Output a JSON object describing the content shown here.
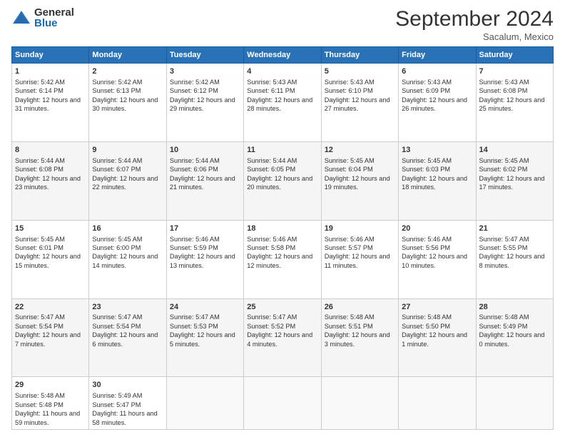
{
  "logo": {
    "general": "General",
    "blue": "Blue"
  },
  "title": "September 2024",
  "location": "Sacalum, Mexico",
  "days_header": [
    "Sunday",
    "Monday",
    "Tuesday",
    "Wednesday",
    "Thursday",
    "Friday",
    "Saturday"
  ],
  "weeks": [
    [
      {
        "day": "1",
        "info": "Sunrise: 5:42 AM\nSunset: 6:14 PM\nDaylight: 12 hours and 31 minutes."
      },
      {
        "day": "2",
        "info": "Sunrise: 5:42 AM\nSunset: 6:13 PM\nDaylight: 12 hours and 30 minutes."
      },
      {
        "day": "3",
        "info": "Sunrise: 5:42 AM\nSunset: 6:12 PM\nDaylight: 12 hours and 29 minutes."
      },
      {
        "day": "4",
        "info": "Sunrise: 5:43 AM\nSunset: 6:11 PM\nDaylight: 12 hours and 28 minutes."
      },
      {
        "day": "5",
        "info": "Sunrise: 5:43 AM\nSunset: 6:10 PM\nDaylight: 12 hours and 27 minutes."
      },
      {
        "day": "6",
        "info": "Sunrise: 5:43 AM\nSunset: 6:09 PM\nDaylight: 12 hours and 26 minutes."
      },
      {
        "day": "7",
        "info": "Sunrise: 5:43 AM\nSunset: 6:08 PM\nDaylight: 12 hours and 25 minutes."
      }
    ],
    [
      {
        "day": "8",
        "info": "Sunrise: 5:44 AM\nSunset: 6:08 PM\nDaylight: 12 hours and 23 minutes."
      },
      {
        "day": "9",
        "info": "Sunrise: 5:44 AM\nSunset: 6:07 PM\nDaylight: 12 hours and 22 minutes."
      },
      {
        "day": "10",
        "info": "Sunrise: 5:44 AM\nSunset: 6:06 PM\nDaylight: 12 hours and 21 minutes."
      },
      {
        "day": "11",
        "info": "Sunrise: 5:44 AM\nSunset: 6:05 PM\nDaylight: 12 hours and 20 minutes."
      },
      {
        "day": "12",
        "info": "Sunrise: 5:45 AM\nSunset: 6:04 PM\nDaylight: 12 hours and 19 minutes."
      },
      {
        "day": "13",
        "info": "Sunrise: 5:45 AM\nSunset: 6:03 PM\nDaylight: 12 hours and 18 minutes."
      },
      {
        "day": "14",
        "info": "Sunrise: 5:45 AM\nSunset: 6:02 PM\nDaylight: 12 hours and 17 minutes."
      }
    ],
    [
      {
        "day": "15",
        "info": "Sunrise: 5:45 AM\nSunset: 6:01 PM\nDaylight: 12 hours and 15 minutes."
      },
      {
        "day": "16",
        "info": "Sunrise: 5:45 AM\nSunset: 6:00 PM\nDaylight: 12 hours and 14 minutes."
      },
      {
        "day": "17",
        "info": "Sunrise: 5:46 AM\nSunset: 5:59 PM\nDaylight: 12 hours and 13 minutes."
      },
      {
        "day": "18",
        "info": "Sunrise: 5:46 AM\nSunset: 5:58 PM\nDaylight: 12 hours and 12 minutes."
      },
      {
        "day": "19",
        "info": "Sunrise: 5:46 AM\nSunset: 5:57 PM\nDaylight: 12 hours and 11 minutes."
      },
      {
        "day": "20",
        "info": "Sunrise: 5:46 AM\nSunset: 5:56 PM\nDaylight: 12 hours and 10 minutes."
      },
      {
        "day": "21",
        "info": "Sunrise: 5:47 AM\nSunset: 5:55 PM\nDaylight: 12 hours and 8 minutes."
      }
    ],
    [
      {
        "day": "22",
        "info": "Sunrise: 5:47 AM\nSunset: 5:54 PM\nDaylight: 12 hours and 7 minutes."
      },
      {
        "day": "23",
        "info": "Sunrise: 5:47 AM\nSunset: 5:54 PM\nDaylight: 12 hours and 6 minutes."
      },
      {
        "day": "24",
        "info": "Sunrise: 5:47 AM\nSunset: 5:53 PM\nDaylight: 12 hours and 5 minutes."
      },
      {
        "day": "25",
        "info": "Sunrise: 5:47 AM\nSunset: 5:52 PM\nDaylight: 12 hours and 4 minutes."
      },
      {
        "day": "26",
        "info": "Sunrise: 5:48 AM\nSunset: 5:51 PM\nDaylight: 12 hours and 3 minutes."
      },
      {
        "day": "27",
        "info": "Sunrise: 5:48 AM\nSunset: 5:50 PM\nDaylight: 12 hours and 1 minute."
      },
      {
        "day": "28",
        "info": "Sunrise: 5:48 AM\nSunset: 5:49 PM\nDaylight: 12 hours and 0 minutes."
      }
    ],
    [
      {
        "day": "29",
        "info": "Sunrise: 5:48 AM\nSunset: 5:48 PM\nDaylight: 11 hours and 59 minutes."
      },
      {
        "day": "30",
        "info": "Sunrise: 5:49 AM\nSunset: 5:47 PM\nDaylight: 11 hours and 58 minutes."
      },
      {
        "day": "",
        "info": ""
      },
      {
        "day": "",
        "info": ""
      },
      {
        "day": "",
        "info": ""
      },
      {
        "day": "",
        "info": ""
      },
      {
        "day": "",
        "info": ""
      }
    ]
  ]
}
